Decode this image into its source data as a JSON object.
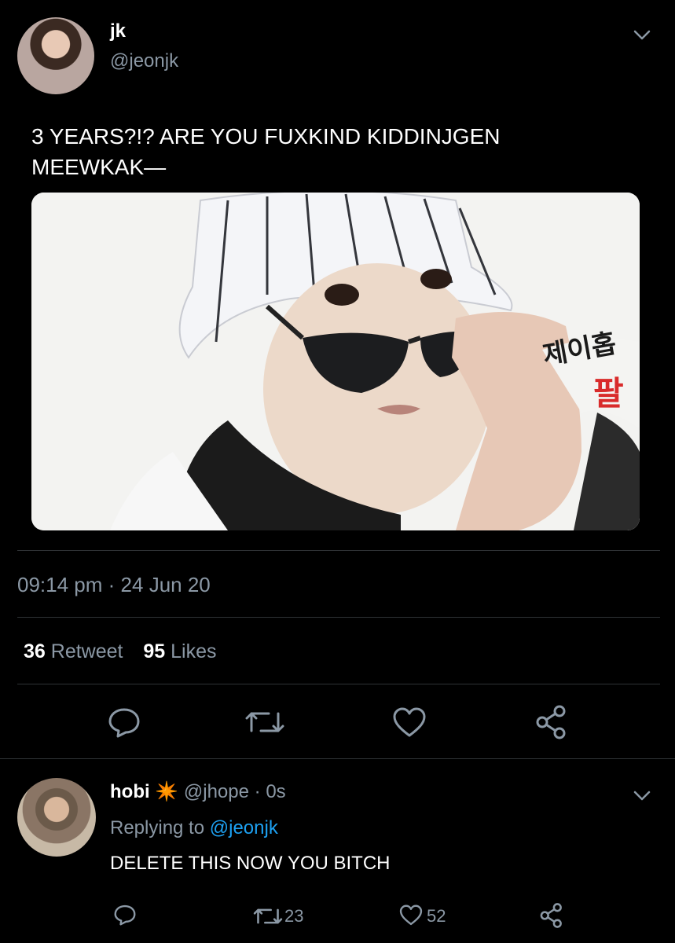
{
  "tweet": {
    "name": "jk",
    "handle": "@jeonjk",
    "text_line1": "3 YEARS?!? ARE YOU FUXKIND KIDDINJGEN",
    "text_line2": "MEEWKAK—",
    "media_overlay_text1": "제이홉",
    "media_overlay_text2": "팔",
    "time": "09:14 pm",
    "sep": "·",
    "date": "24 Jun 20",
    "retweet_count": "36",
    "retweet_label": "Retweet",
    "like_count": "95",
    "like_label": "Likes"
  },
  "reply": {
    "name": "hobi",
    "emoji": "✴️",
    "handle": "@jhope",
    "sep": "·",
    "age": "0s",
    "replying_label": "Replying to",
    "replying_to": "@jeonjk",
    "text": "DELETE THIS NOW YOU BITCH",
    "retweet_count": "23",
    "like_count": "52"
  },
  "colors": {
    "background": "#000000",
    "muted": "#8b98a5",
    "link": "#1da1f2",
    "divider": "#2f3336"
  },
  "icons": {
    "reply": "reply-icon",
    "retweet": "retweet-icon",
    "like": "heart-icon",
    "share": "share-icon",
    "menu": "chevron-down-icon"
  }
}
